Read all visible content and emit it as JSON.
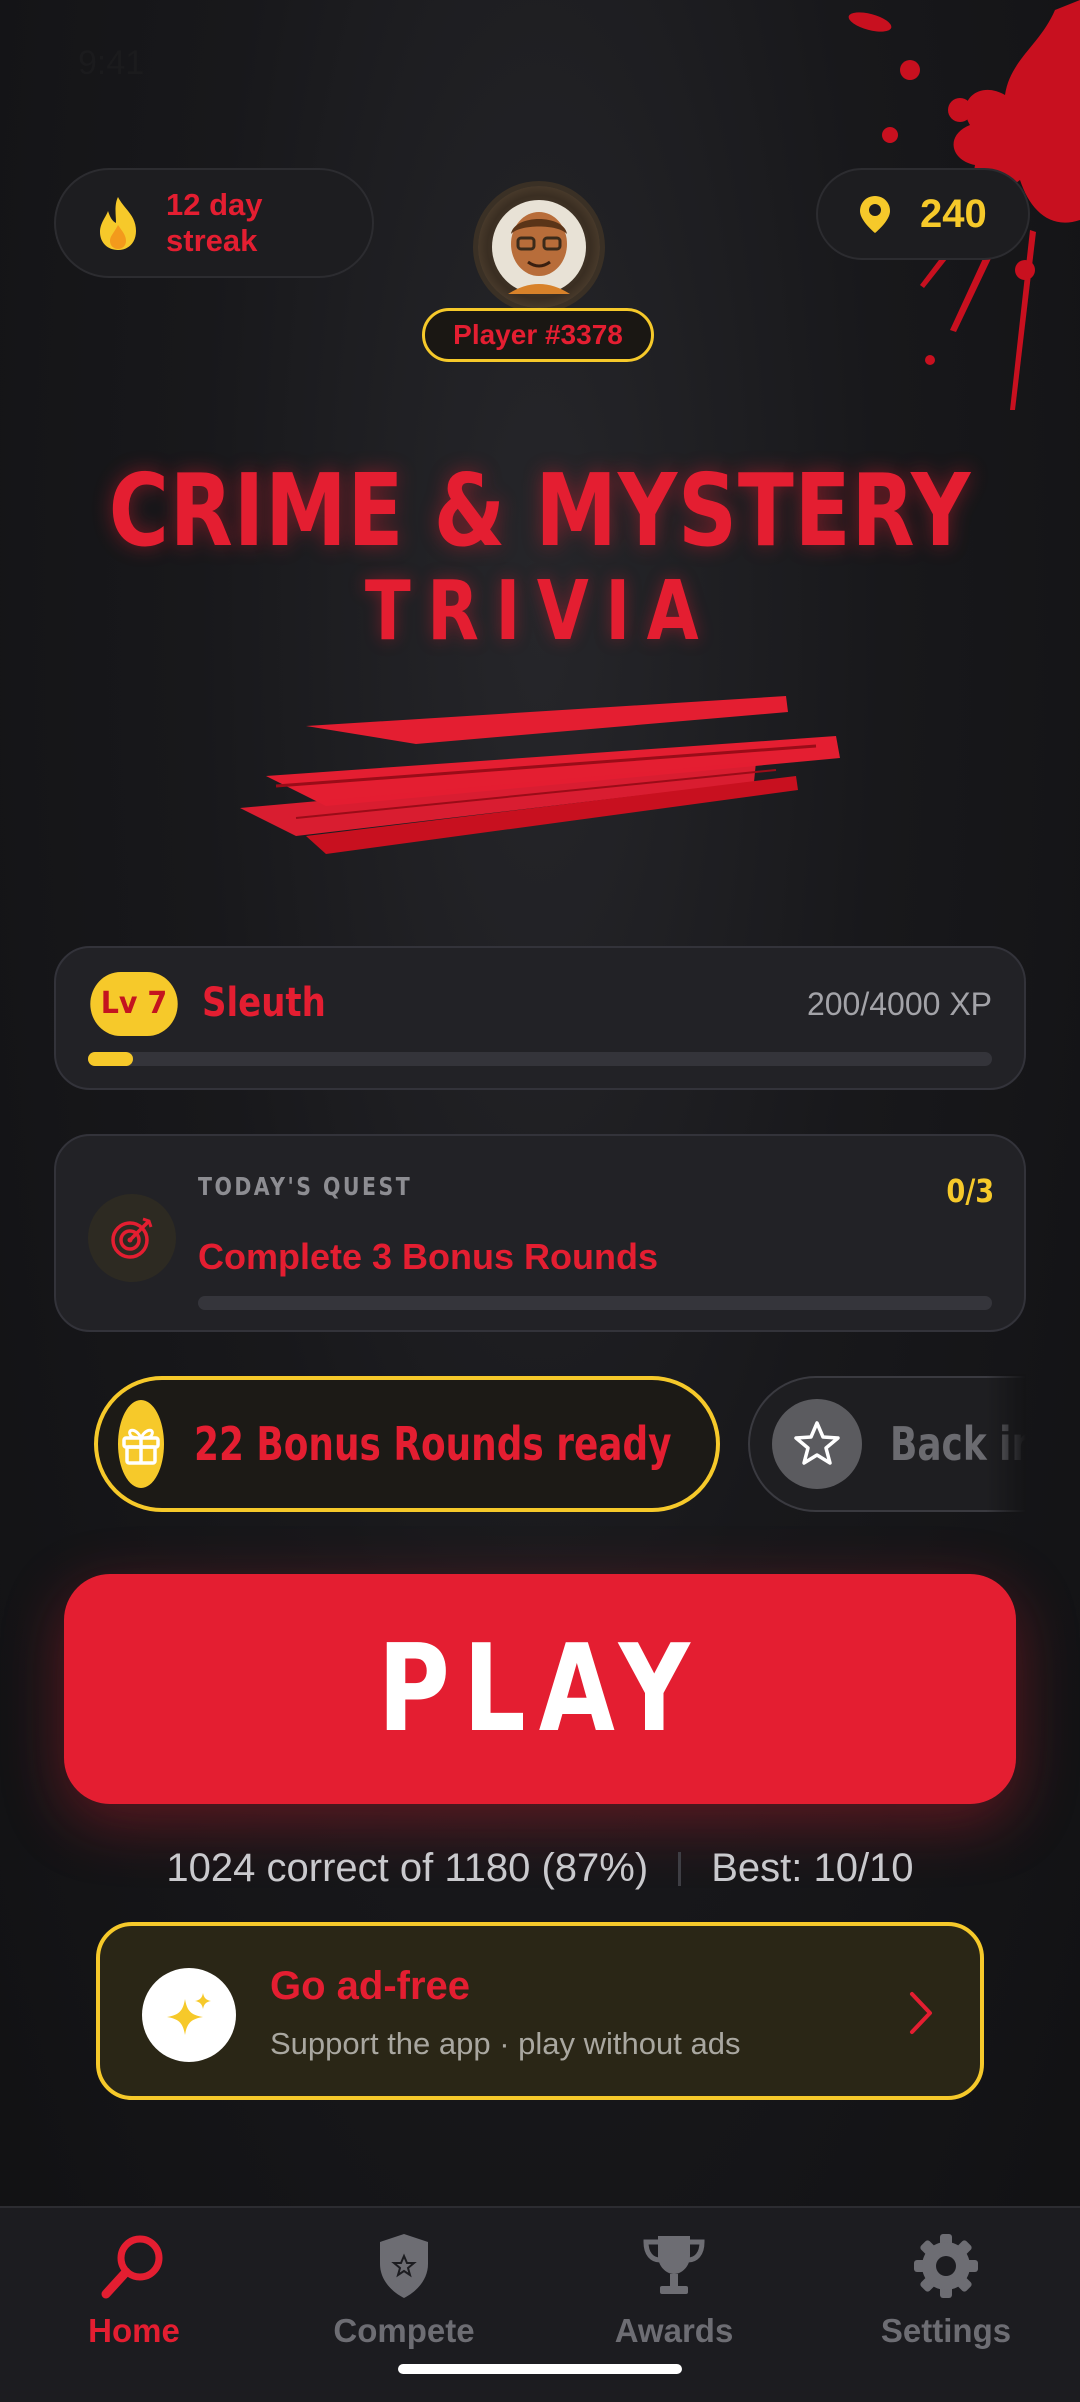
{
  "status": {
    "time": "9:41"
  },
  "header": {
    "streak_label": "12 day streak",
    "coins": "240",
    "player_badge": "Player #3378"
  },
  "title": {
    "line1": "CRIME & MYSTERY",
    "line2": "TRIVIA"
  },
  "level": {
    "badge": "Lv 7",
    "name": "Sleuth",
    "xp_text": "200/4000 XP",
    "progress_fraction": 0.05
  },
  "quest": {
    "label": "TODAY'S QUEST",
    "count": "0/3",
    "title": "Complete 3 Bonus Rounds",
    "progress_fraction": 0
  },
  "chips": {
    "bonus_label": "22 Bonus Rounds ready",
    "back_label": "Back in"
  },
  "play_label": "PLAY",
  "stats": {
    "correct": "1024 correct of 1180 (87%)",
    "best": "Best: 10/10"
  },
  "promo": {
    "title": "Go ad-free",
    "subtitle": "Support the app · play without ads"
  },
  "nav": {
    "home": "Home",
    "compete": "Compete",
    "awards": "Awards",
    "settings": "Settings"
  },
  "colors": {
    "accent": "#e41e31",
    "gold": "#f6c92a",
    "background": "#141416"
  },
  "icons": [
    "flame-icon",
    "map-pin-icon",
    "target-icon",
    "gift-icon",
    "star-icon",
    "sparkles-icon",
    "chevron-right-icon",
    "search-icon",
    "shield-icon",
    "trophy-icon",
    "gear-icon"
  ]
}
